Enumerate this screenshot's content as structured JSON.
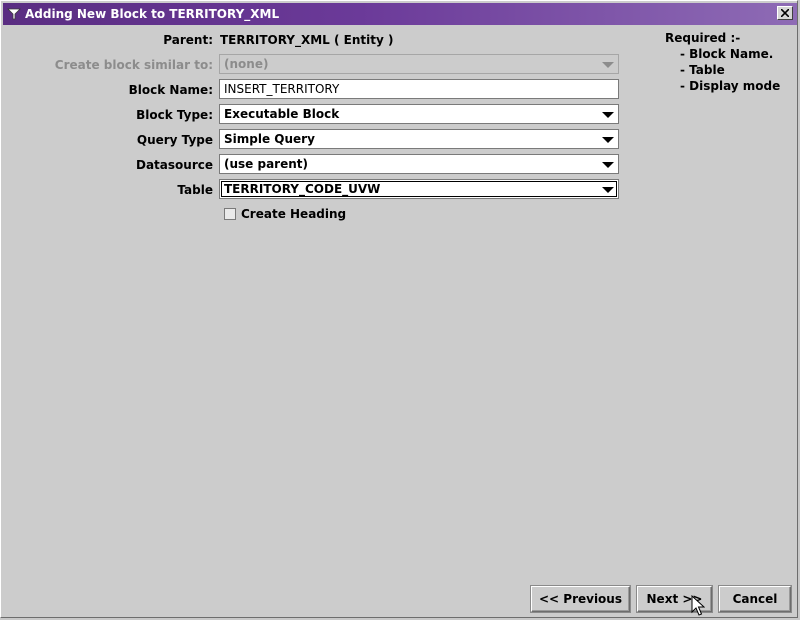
{
  "window": {
    "title": "Adding New Block to TERRITORY_XML",
    "close_glyph": "✕"
  },
  "form": {
    "parent_label": "Parent:",
    "parent_value": "TERRITORY_XML ( Entity )",
    "similar_label": "Create block similar to:",
    "similar_value": "(none)",
    "block_name_label": "Block Name:",
    "block_name_value": "INSERT_TERRITORY",
    "block_type_label": "Block Type:",
    "block_type_value": "Executable Block",
    "query_type_label": "Query Type",
    "query_type_value": "Simple Query",
    "datasource_label": "Datasource",
    "datasource_value": "(use parent)",
    "table_label": "Table",
    "table_value": "TERRITORY_CODE_UVW",
    "create_heading_label": "Create Heading",
    "create_heading_checked": false
  },
  "required": {
    "title": "Required :-",
    "items": [
      "- Block Name.",
      "- Table",
      "- Display mode"
    ]
  },
  "buttons": {
    "previous": "<< Previous",
    "next": "Next >>",
    "cancel": "Cancel"
  },
  "icons": {
    "app": "funnel-icon",
    "close": "close-icon",
    "dropdown": "chevron-down-icon",
    "cursor": "mouse-pointer-icon"
  },
  "colors": {
    "titlebar": "#5a2d82",
    "background": "#cccccc",
    "disabled_text": "#8c8c8c"
  }
}
